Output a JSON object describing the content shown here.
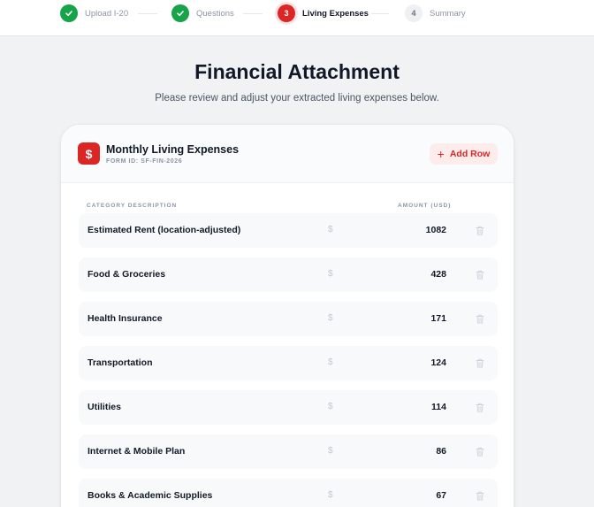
{
  "stepper": {
    "steps": [
      {
        "number": "1",
        "label": "Upload I-20",
        "state": "done"
      },
      {
        "number": "2",
        "label": "Questions",
        "state": "done"
      },
      {
        "number": "3",
        "label": "Living Expenses",
        "state": "active"
      },
      {
        "number": "4",
        "label": "Summary",
        "state": "todo"
      }
    ]
  },
  "header": {
    "title": "Financial Attachment",
    "subtitle": "Please review and adjust your extracted living expenses below."
  },
  "card": {
    "icon": "dollar-icon",
    "icon_glyph": "$",
    "title": "Monthly Living Expenses",
    "form_id": "FORM ID: SF-FIN-2026",
    "add_row_label": "Add Row",
    "add_row_plus": "+",
    "col_category": "CATEGORY DESCRIPTION",
    "col_amount": "AMOUNT (USD)",
    "currency_symbol": "$",
    "rows": [
      {
        "category": "Estimated Rent (location-adjusted)",
        "amount": "1082"
      },
      {
        "category": "Food & Groceries",
        "amount": "428"
      },
      {
        "category": "Health Insurance",
        "amount": "171"
      },
      {
        "category": "Transportation",
        "amount": "124"
      },
      {
        "category": "Utilities",
        "amount": "114"
      },
      {
        "category": "Internet & Mobile Plan",
        "amount": "86"
      },
      {
        "category": "Books & Academic Supplies",
        "amount": "67"
      }
    ]
  },
  "colors": {
    "accent": "#dc2626",
    "done": "#16a34a",
    "background": "#f1f2f4"
  }
}
